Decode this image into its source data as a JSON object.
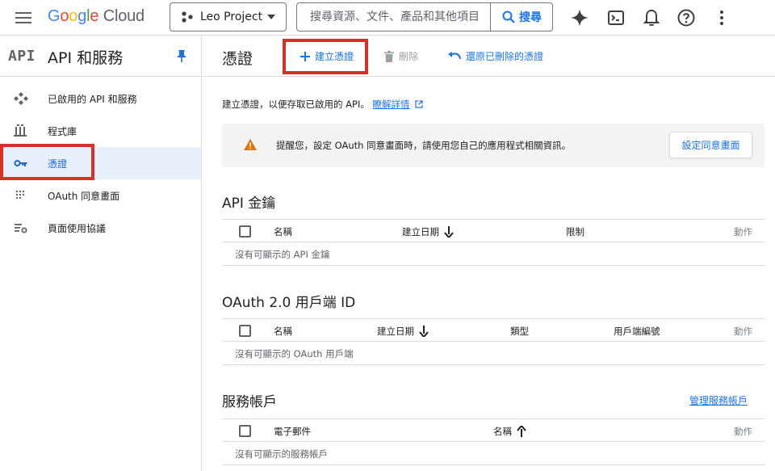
{
  "topbar": {
    "logo": {
      "google_letters": [
        "G",
        "o",
        "o",
        "g",
        "l",
        "e"
      ],
      "product": "Cloud"
    },
    "project": {
      "name": "Leo Project"
    },
    "search": {
      "placeholder": "搜尋資源、文件、產品和其他項目",
      "button_label": "搜尋"
    },
    "icons": [
      "menu-icon",
      "gemini-icon",
      "cloud-shell-icon",
      "bell-icon",
      "help-icon",
      "more-vert-icon"
    ]
  },
  "sidebar": {
    "logo_text": "API",
    "title": "API 和服務",
    "items": [
      {
        "label": "已啟用的 API 和服務",
        "icon": "api-diamond-icon"
      },
      {
        "label": "程式庫",
        "icon": "library-icon"
      },
      {
        "label": "憑證",
        "icon": "key-icon",
        "active": true
      },
      {
        "label": "OAuth 同意畫面",
        "icon": "oauth-icon"
      },
      {
        "label": "頁面使用協議",
        "icon": "settings-list-icon"
      }
    ]
  },
  "main": {
    "title": "憑證",
    "actions": {
      "create": "建立憑證",
      "delete": "刪除",
      "restore": "還原已刪除的憑證"
    },
    "intro": {
      "text": "建立憑證，以便存取已啟用的 API。",
      "learn_more": "瞭解詳情"
    },
    "notice": {
      "text": "提醒您，設定 OAuth 同意畫面時，請使用您自己的應用程式相關資訊。",
      "button": "設定同意畫面"
    },
    "api_keys": {
      "title": "API 金鑰",
      "columns": {
        "name": "名稱",
        "created": "建立日期",
        "restriction": "限制",
        "actions": "動作"
      },
      "empty": "沒有可顯示的 API 金鑰"
    },
    "oauth": {
      "title": "OAuth 2.0 用戶端 ID",
      "columns": {
        "name": "名稱",
        "created": "建立日期",
        "type": "類型",
        "client_id": "用戶端編號",
        "actions": "動作"
      },
      "empty": "沒有可顯示的 OAuth 用戶端"
    },
    "service_accounts": {
      "title": "服務帳戶",
      "manage_link": "管理服務帳戶",
      "columns": {
        "email": "電子郵件",
        "name": "名稱",
        "actions": "動作"
      },
      "empty": "沒有可顯示的服務帳戶"
    }
  },
  "colors": {
    "accent": "#1a73e8",
    "highlight": "#d93025",
    "active_bg": "#e8f0fe",
    "warning": "#e37400"
  }
}
